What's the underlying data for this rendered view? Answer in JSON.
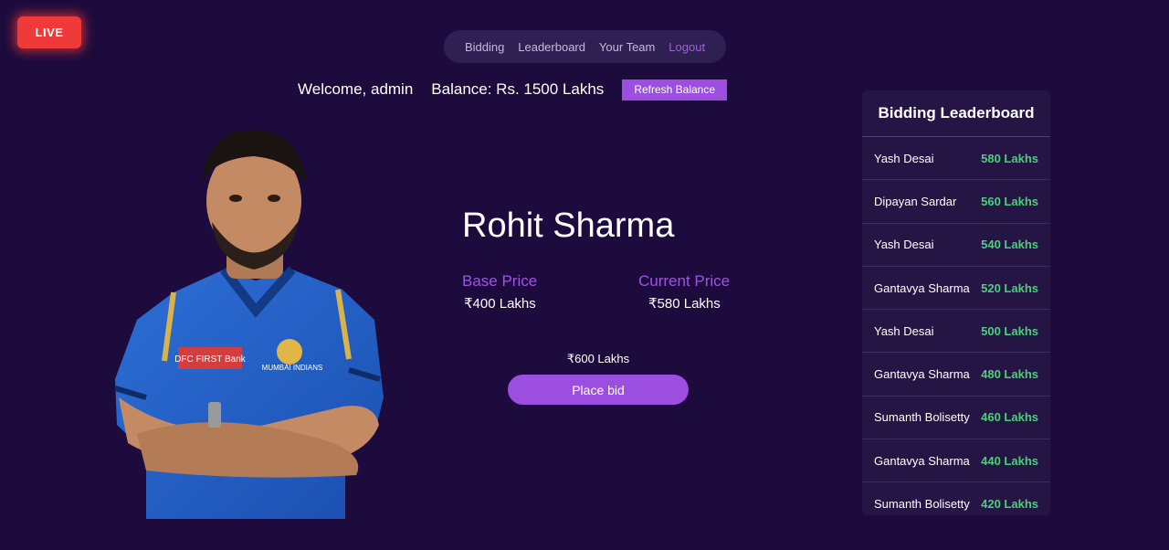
{
  "live_badge": "LIVE",
  "nav": {
    "items": [
      {
        "label": "Bidding"
      },
      {
        "label": "Leaderboard"
      },
      {
        "label": "Your Team"
      },
      {
        "label": "Logout"
      }
    ]
  },
  "header": {
    "welcome": "Welcome, admin",
    "balance": "Balance: Rs. 1500 Lakhs",
    "refresh_label": "Refresh Balance"
  },
  "player": {
    "name": "Rohit Sharma",
    "base_price_label": "Base Price",
    "base_price_value": "₹400 Lakhs",
    "current_price_label": "Current Price",
    "current_price_value": "₹580 Lakhs",
    "next_bid": "₹600 Lakhs",
    "place_bid_label": "Place bid",
    "jersey_sponsor": "DFC FIRST Bank",
    "jersey_team": "MUMBAI INDIANS"
  },
  "leaderboard": {
    "title": "Bidding Leaderboard",
    "entries": [
      {
        "name": "Yash Desai",
        "amount": "580 Lakhs"
      },
      {
        "name": "Dipayan Sardar",
        "amount": "560 Lakhs"
      },
      {
        "name": "Yash Desai",
        "amount": "540 Lakhs"
      },
      {
        "name": "Gantavya Sharma",
        "amount": "520 Lakhs"
      },
      {
        "name": "Yash Desai",
        "amount": "500 Lakhs"
      },
      {
        "name": "Gantavya Sharma",
        "amount": "480 Lakhs"
      },
      {
        "name": "Sumanth Bolisetty",
        "amount": "460 Lakhs"
      },
      {
        "name": "Gantavya Sharma",
        "amount": "440 Lakhs"
      },
      {
        "name": "Sumanth Bolisetty",
        "amount": "420 Lakhs"
      }
    ]
  },
  "colors": {
    "background": "#1c0b3c",
    "accent": "#9b4ee0",
    "live": "#f03a3a",
    "amount": "#4ccf7a"
  }
}
